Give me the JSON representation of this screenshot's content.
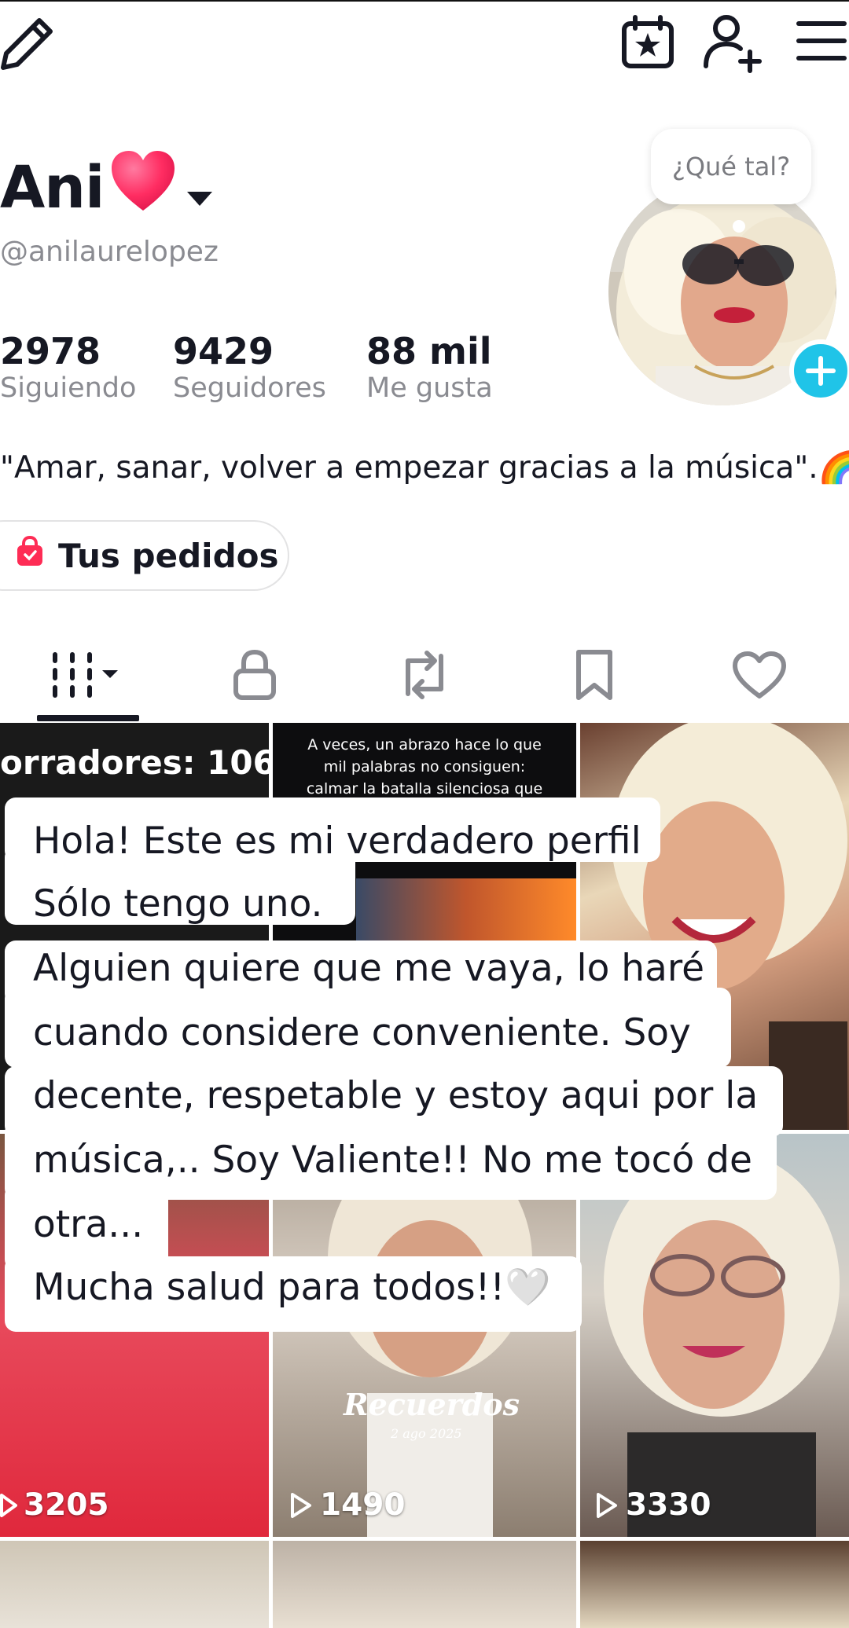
{
  "header": {
    "edit_icon": "pencil-icon",
    "calendar_icon": "calendar-star-icon",
    "add_friend_icon": "person-add-icon",
    "menu_icon": "hamburger-menu-icon"
  },
  "profile": {
    "name": "Ani",
    "name_emoji": "❤️",
    "handle": "@anilaurelopez",
    "bubble": "¿Qué tal?",
    "stats": [
      {
        "value": "2978",
        "label": "Siguiendo"
      },
      {
        "value": "9429",
        "label": "Seguidores"
      },
      {
        "value": "88 mil",
        "label": "Me gusta"
      }
    ],
    "bio": "\"Amar, sanar, volver a empezar gracias a la música\".🌈",
    "orders_label": "Tus pedidos"
  },
  "tabs": [
    {
      "name": "videos",
      "icon": "grid-icon",
      "active": true
    },
    {
      "name": "private",
      "icon": "lock-icon",
      "active": false
    },
    {
      "name": "reposts",
      "icon": "repost-icon",
      "active": false
    },
    {
      "name": "saved",
      "icon": "bookmark-icon",
      "active": false
    },
    {
      "name": "liked",
      "icon": "heart-icon",
      "active": false
    }
  ],
  "grid": {
    "cell1_text": "orradores: 106",
    "cell2_text": [
      "A veces, un abrazo hace lo que",
      "mil palabras no consiguen:",
      "calmar la batalla silenciosa que"
    ],
    "views": [
      "3205",
      "1490",
      "3330"
    ],
    "recuerdos_title": "Recuerdos",
    "recuerdos_date": "2 ago 2025"
  },
  "overlay_lines": [
    "Hola! Este es mi verdadero perfil",
    "Sólo tengo uno.",
    "Alguien quiere que me vaya, lo haré",
    "cuando considere conveniente. Soy",
    "decente, respetable y estoy aqui por la",
    "música,.. Soy Valiente!! No me tocó de",
    "otra...",
    "Mucha salud para todos!!🤍"
  ],
  "colors": {
    "accent_blue": "#20c4e8",
    "text_primary": "#161823",
    "text_secondary": "#8a8b91"
  }
}
